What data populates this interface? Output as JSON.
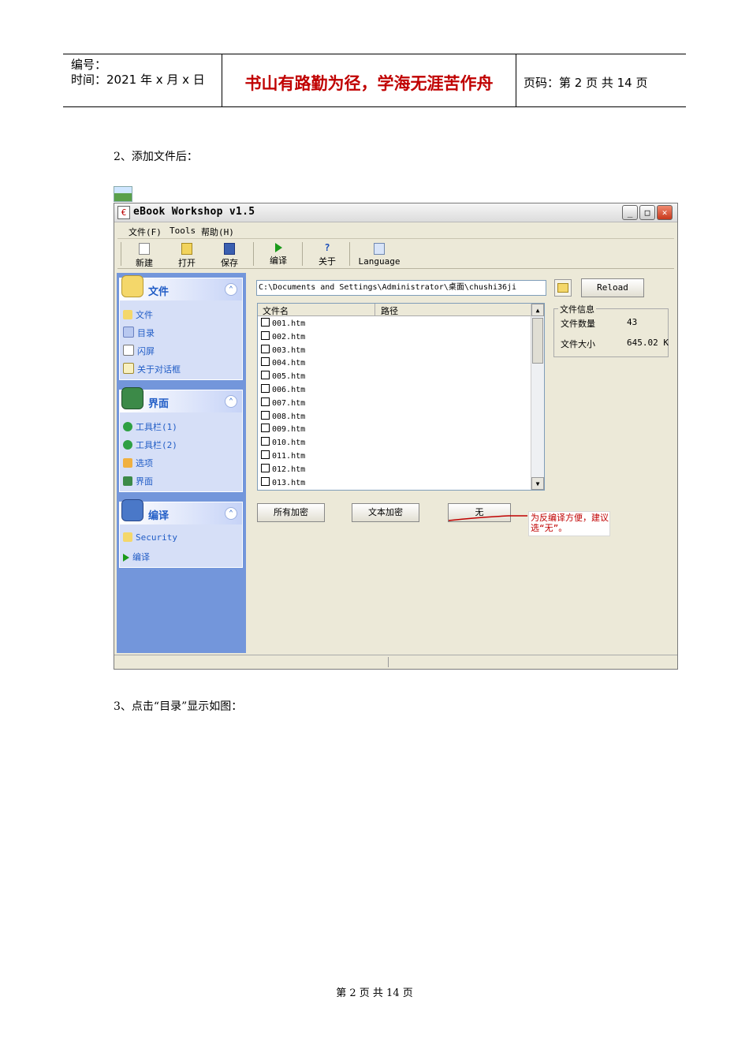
{
  "header": {
    "serial_label": "编号：",
    "time_label": "时间：2021 年 x 月 x 日",
    "motto": "书山有路勤为径，学海无涯苦作舟",
    "page_info": "页码：第 2 页  共 14 页"
  },
  "body": {
    "step2": "2、添加文件后：",
    "step3": "3、点击“目录”显示如图："
  },
  "screenshot": {
    "title": "eBook Workshop v1.5",
    "menu": [
      "文件(F)",
      "Tools",
      "帮助(H)"
    ],
    "toolbar": [
      "新建",
      "打开",
      "保存",
      "编译",
      "关于",
      "Language"
    ],
    "groups": [
      {
        "title": "文件",
        "items": [
          "文件",
          "目录",
          "闪屏",
          "关于对话框"
        ]
      },
      {
        "title": "界面",
        "items": [
          "工具栏(1)",
          "工具栏(2)",
          "选项",
          "界面"
        ]
      },
      {
        "title": "编译",
        "items": [
          "Security",
          "编译"
        ]
      }
    ],
    "path": "C:\\Documents and Settings\\Administrator\\桌面\\chushi36ji",
    "reload": "Reload",
    "columns": [
      "文件名",
      "路径"
    ],
    "files": [
      "001.htm",
      "002.htm",
      "003.htm",
      "004.htm",
      "005.htm",
      "006.htm",
      "007.htm",
      "008.htm",
      "009.htm",
      "010.htm",
      "011.htm",
      "012.htm",
      "013.htm"
    ],
    "info": {
      "legend": "文件信息",
      "count_label": "文件数量",
      "count_value": "43",
      "size_label": "文件大小",
      "size_value": "645.02 K"
    },
    "buttons": [
      "所有加密",
      "文本加密",
      "无"
    ],
    "note": "为反编译方便，建议选“无”。"
  },
  "footer": "第 2 页 共 14 页"
}
